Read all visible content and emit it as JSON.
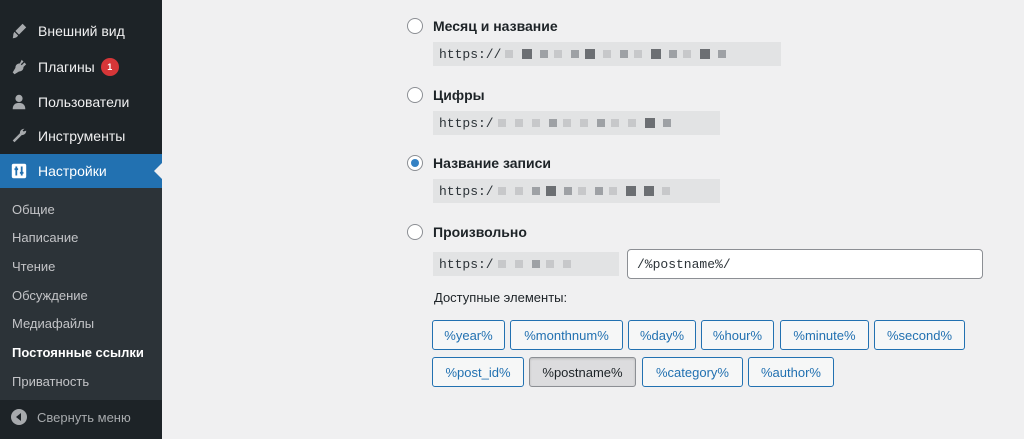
{
  "sidebar": {
    "menu": [
      {
        "label": "Внешний вид",
        "icon": "paintbrush-icon"
      },
      {
        "label": "Плагины",
        "icon": "plugin-icon",
        "badge": "1"
      },
      {
        "label": "Пользователи",
        "icon": "user-icon"
      },
      {
        "label": "Инструменты",
        "icon": "wrench-icon"
      },
      {
        "label": "Настройки",
        "icon": "settings-icon",
        "active": true
      }
    ],
    "submenu": [
      "Общие",
      "Написание",
      "Чтение",
      "Обсуждение",
      "Медиафайлы",
      "Постоянные ссылки",
      "Приватность"
    ],
    "current_submenu": "Постоянные ссылки",
    "collapse_label": "Свернуть меню"
  },
  "permalinks": {
    "options": [
      {
        "label": "Месяц и название",
        "prefix": "https://",
        "checked": false
      },
      {
        "label": "Цифры",
        "prefix": "https:/",
        "checked": false
      },
      {
        "label": "Название записи",
        "prefix": "https:/",
        "checked": true
      },
      {
        "label": "Произвольно",
        "prefix": "https:/",
        "checked": false
      }
    ],
    "custom_value": "/%postname%/",
    "available_label": "Доступные элементы:",
    "tags": [
      "%year%",
      "%monthnum%",
      "%day%",
      "%hour%",
      "%minute%",
      "%second%",
      "%post_id%",
      "%postname%",
      "%category%",
      "%author%"
    ],
    "pressed_tag": "%postname%"
  },
  "colors": {
    "sidebar_bg": "#1d2327",
    "accent": "#2271b1",
    "badge": "#d63638"
  }
}
